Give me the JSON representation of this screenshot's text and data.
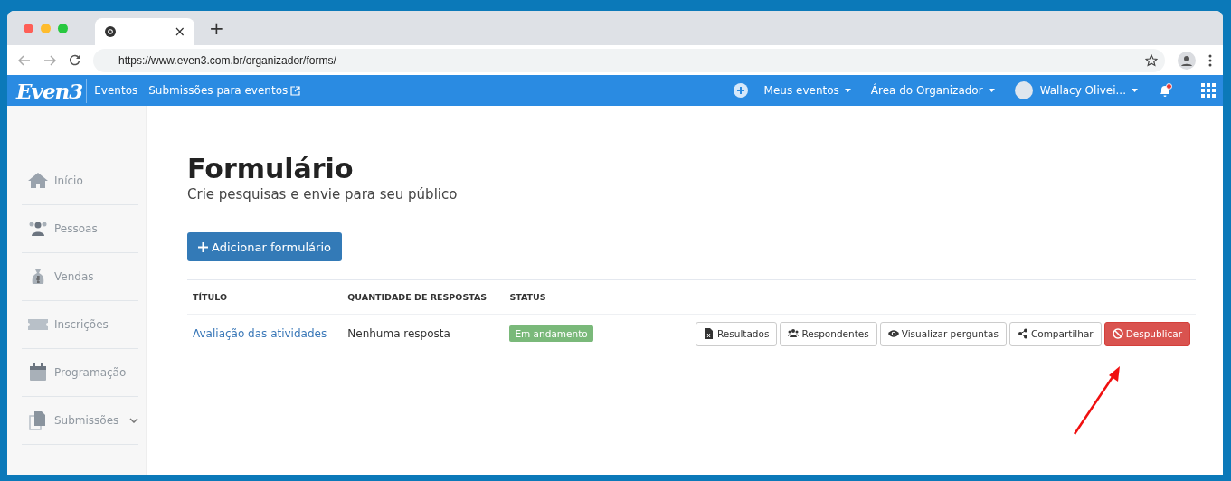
{
  "browser": {
    "tab_close": "×",
    "new_tab": "+",
    "url": "https://www.even3.com.br/organizador/forms/"
  },
  "topnav": {
    "logo": "Even3",
    "section": "Eventos",
    "link": "Submissões para eventos",
    "menus": [
      "Meus eventos",
      "Área do Organizador"
    ],
    "user": "Wallacy Olivei...",
    "notification": true
  },
  "sidebar": {
    "items": [
      {
        "label": "Início",
        "kind": "link"
      },
      {
        "label": "Pessoas",
        "kind": "link"
      },
      {
        "label": "Vendas",
        "kind": "link"
      },
      {
        "label": "Inscrições",
        "kind": "link"
      },
      {
        "label": "Programação",
        "kind": "link"
      },
      {
        "label": "Submissões",
        "kind": "group"
      }
    ]
  },
  "page": {
    "title": "Formulário",
    "subtitle": "Crie pesquisas e envie para seu público",
    "add_button": "Adicionar formulário"
  },
  "table": {
    "columns": [
      "TÍTULO",
      "QUANTIDADE DE RESPOSTAS",
      "STATUS"
    ],
    "rows": [
      {
        "title": "Avaliação das atividades",
        "responses": "Nenhuma resposta",
        "status": {
          "label": "Em andamento",
          "color": "#7ab97a"
        },
        "actions": [
          {
            "label": "Resultados",
            "kind": "default"
          },
          {
            "label": "Respondentes",
            "kind": "default"
          },
          {
            "label": "Visualizar perguntas",
            "kind": "default"
          },
          {
            "label": "Compartilhar",
            "kind": "default"
          },
          {
            "label": "Despublicar",
            "kind": "danger"
          }
        ]
      }
    ]
  }
}
